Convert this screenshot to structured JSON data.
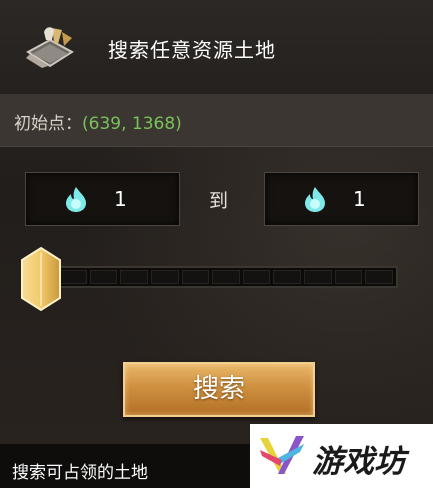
{
  "header": {
    "title": "搜索任意资源土地",
    "icon": "land-emblem-icon"
  },
  "start_point": {
    "label": "初始点：",
    "value": "(639, 1368)"
  },
  "range": {
    "from_value": "1",
    "to_label": "到",
    "to_value": "1",
    "resource_icon": "resource-orb-icon"
  },
  "slider": {
    "level_fraction": 0
  },
  "actions": {
    "search_label": "搜索"
  },
  "footer": {
    "hint": "搜索可占领的土地"
  },
  "watermark": {
    "text": "游戏坊",
    "logo": "watermark-logo"
  },
  "colors": {
    "accent_gold": "#cf9040",
    "coordinate_green": "#79c25a",
    "resource_cyan": "#7fe8e8"
  }
}
